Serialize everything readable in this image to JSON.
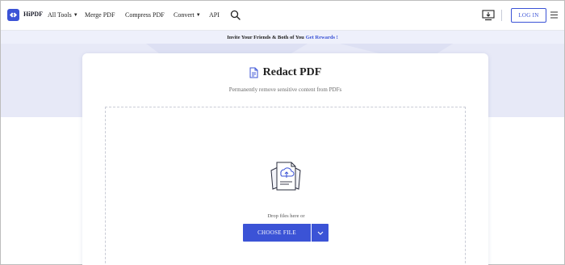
{
  "header": {
    "logo_text": "HiPDF",
    "nav": [
      {
        "label": "All Tools",
        "has_caret": true
      },
      {
        "label": "Merge PDF",
        "has_caret": false
      },
      {
        "label": "Compress PDF",
        "has_caret": false
      },
      {
        "label": "Convert",
        "has_caret": true
      },
      {
        "label": "API",
        "has_caret": false
      }
    ],
    "login_label": "LOG IN",
    "icons": [
      "logo-mark-icon",
      "search-icon",
      "desktop-download-icon",
      "hamburger-menu-icon"
    ]
  },
  "promo": {
    "text": "Invite Your Friends & Both of You",
    "link": "Get Rewards !"
  },
  "main": {
    "title": "Redact PDF",
    "subtitle": "Permanently remove sensitive content from PDFs",
    "drop_text": "Drop files here or",
    "choose_label": "CHOOSE FILE"
  },
  "colors": {
    "accent": "#3b53d6",
    "hero_bg": "#e7e9f7",
    "promo_bg": "#eef0fb"
  }
}
